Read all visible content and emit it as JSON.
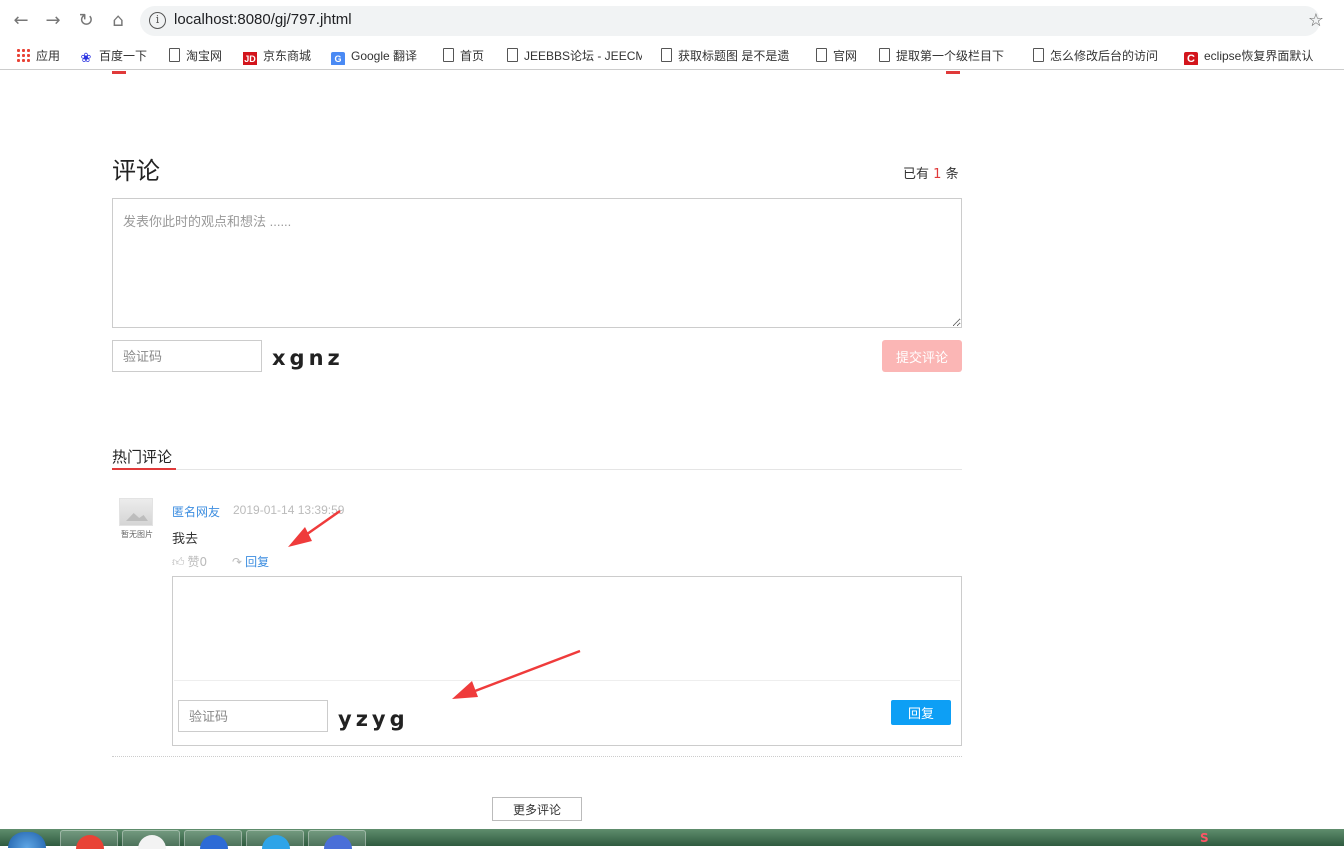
{
  "browser": {
    "url": "localhost:8080/gj/797.jhtml",
    "bookmarks": [
      {
        "label": "应用",
        "icon": "apps-icon"
      },
      {
        "label": "百度一下",
        "icon": "baidu-icon"
      },
      {
        "label": "淘宝网",
        "icon": "page-icon"
      },
      {
        "label": "京东商城",
        "icon": "jd-icon"
      },
      {
        "label": "Google 翻译",
        "icon": "google-translate-icon"
      },
      {
        "label": "首页",
        "icon": "page-icon"
      },
      {
        "label": "JEEBBS论坛 - JEECM",
        "icon": "page-icon"
      },
      {
        "label": "获取标题图 是不是遗",
        "icon": "page-icon"
      },
      {
        "label": "官网",
        "icon": "page-icon"
      },
      {
        "label": "提取第一个级栏目下",
        "icon": "page-icon"
      },
      {
        "label": "怎么修改后台的访问",
        "icon": "page-icon"
      },
      {
        "label": "eclipse恢复界面默认",
        "icon": "c-icon"
      }
    ]
  },
  "comments": {
    "title": "评论",
    "count_prefix": "已有",
    "count": "1",
    "count_suffix": "条",
    "textarea_placeholder": "发表你此时的观点和想法 ......",
    "captcha_placeholder": "验证码",
    "captcha_text": "xgnz",
    "submit_label": "提交评论"
  },
  "hot": {
    "title": "热门评论",
    "items": [
      {
        "avatar_caption": "暂无图片",
        "user": "匿名网友",
        "time": "2019-01-14 13:39:59",
        "text": "我去",
        "like_label": "赞0",
        "reply_label": "回复"
      }
    ],
    "reply_form": {
      "captcha_placeholder": "验证码",
      "captcha_text": "yzyg",
      "submit_label": "回复"
    },
    "more_label": "更多评论"
  },
  "colors": {
    "accent_red": "#e03a3a",
    "link_blue": "#3d8ee0",
    "reply_button_blue": "#0d9ff5",
    "submit_disabled_pink": "#fbb6b5",
    "annotation_arrow_red": "#ef3b3b"
  }
}
